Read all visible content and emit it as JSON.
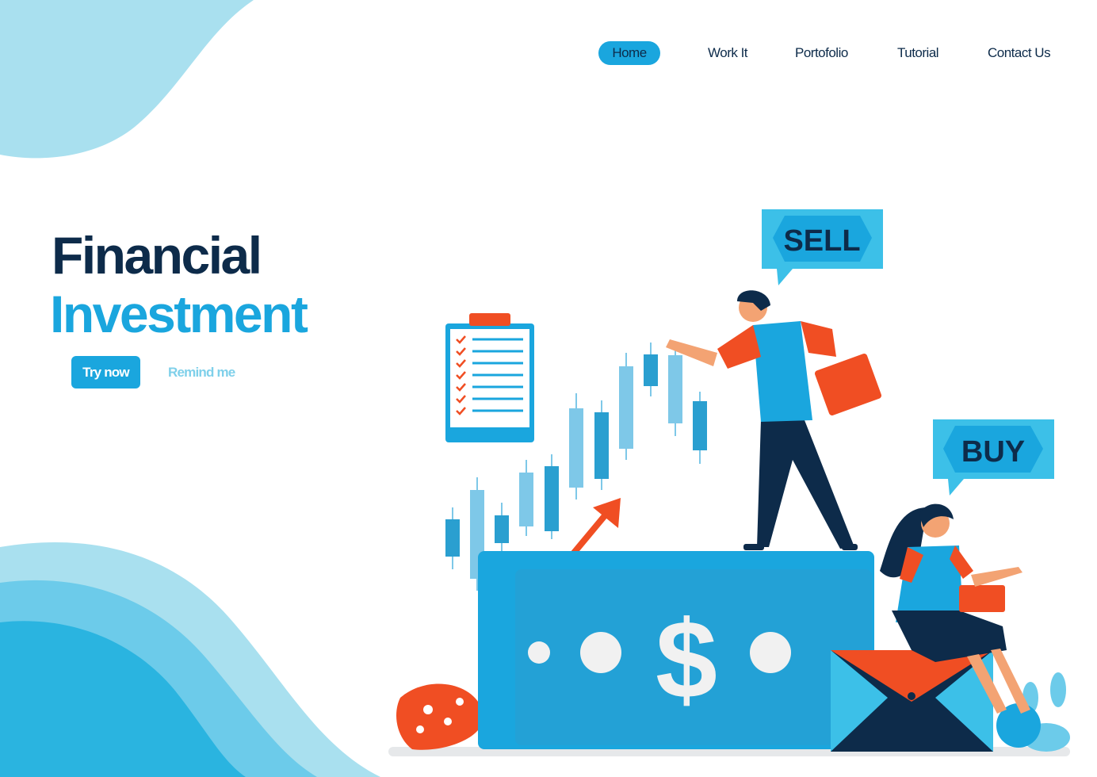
{
  "nav": {
    "items": [
      {
        "label": "Home",
        "active": true
      },
      {
        "label": "Work It"
      },
      {
        "label": "Portofolio"
      },
      {
        "label": "Tutorial"
      },
      {
        "label": "Contact Us"
      }
    ]
  },
  "hero": {
    "title_line1": "Financial",
    "title_line2": "Investment",
    "primary_button": "Try now",
    "secondary_button": "Remind me"
  },
  "illustration": {
    "sell_label": "SELL",
    "buy_label": "BUY",
    "currency_symbol": "$"
  },
  "colors": {
    "navy": "#0d2b4a",
    "accent_blue": "#1aa6de",
    "light_blue": "#a9e0ef",
    "orange": "#f04e23"
  }
}
